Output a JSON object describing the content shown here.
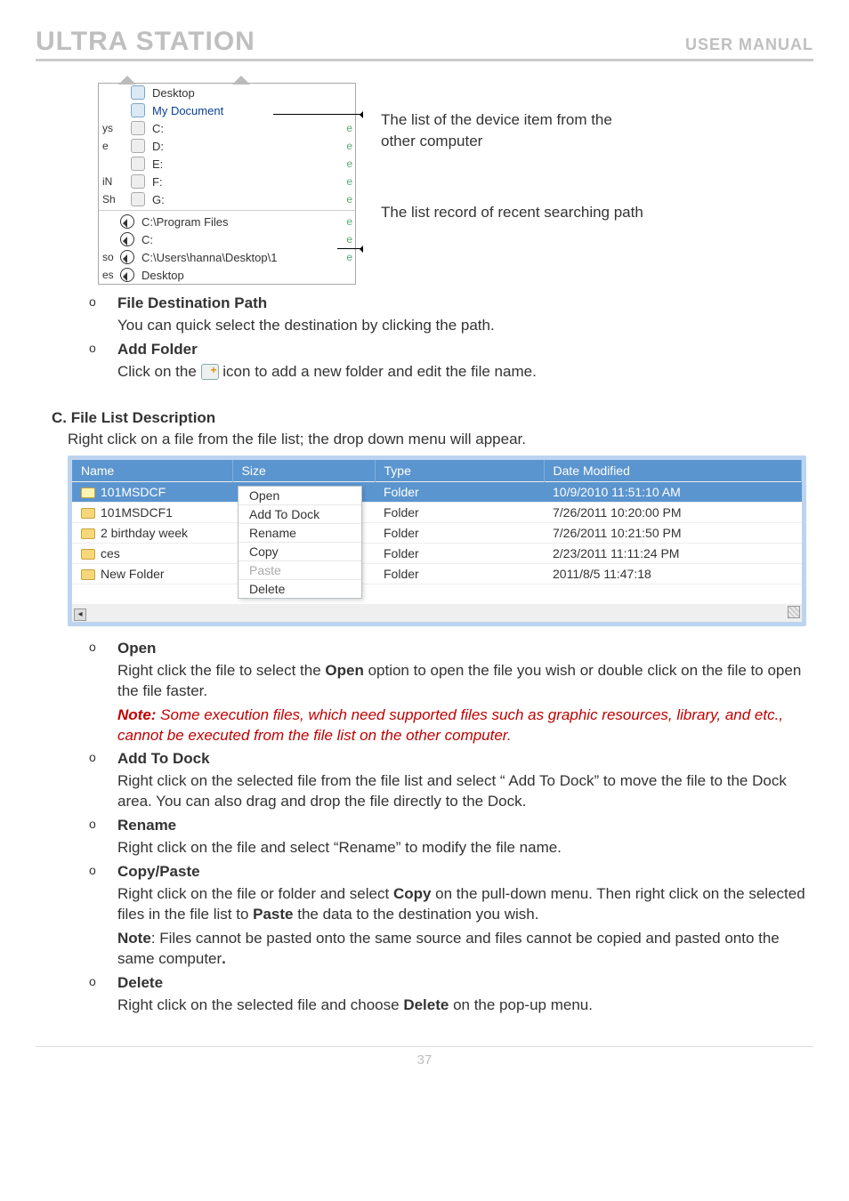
{
  "header": {
    "title": "ULTRA STATION",
    "subtitle": "USER MANUAL"
  },
  "addrcombo": {
    "left_letters": [
      "",
      "",
      "",
      "ys",
      "e",
      "",
      "iN",
      "Sh",
      "",
      "so",
      "es"
    ],
    "items": [
      {
        "label": "Desktop",
        "icon": "folder",
        "sel": false
      },
      {
        "label": "My Document",
        "icon": "folder",
        "sel": true
      },
      {
        "label": "C:",
        "icon": "drive",
        "sel": false
      },
      {
        "label": "D:",
        "icon": "drive",
        "sel": false
      },
      {
        "label": "E:",
        "icon": "drive",
        "sel": false
      },
      {
        "label": "F:",
        "icon": "drive",
        "sel": false
      },
      {
        "label": "G:",
        "icon": "drive",
        "sel": false
      }
    ],
    "history": [
      {
        "label": "C:\\Program Files"
      },
      {
        "label": "C:"
      },
      {
        "label": "C:\\Users\\hanna\\Desktop\\1"
      },
      {
        "label": "Desktop"
      }
    ],
    "right_letters": [
      "",
      "",
      "",
      "e",
      "e",
      "e",
      "e",
      "e",
      "e",
      "e",
      "e"
    ]
  },
  "side": {
    "line1a": "The list of the device item from the",
    "line1b": "other computer",
    "line2": "The list record of recent searching path"
  },
  "bullets": {
    "fdp_title": "File Destination Path",
    "fdp_text": "You can quick select the destination by clicking the path.",
    "af_title": "Add Folder",
    "af_text_pre": "Click on the ",
    "af_text_post": " icon to add a new folder and edit the file name."
  },
  "sectionC": {
    "head": "C.  File List Description",
    "sub": "Right click on a file from the file list; the drop down menu will appear."
  },
  "filelist": {
    "cols": {
      "c1": "Name",
      "c2": "Size",
      "c3": "Type",
      "c4": "Date Modified"
    },
    "rows": [
      {
        "name": "101MSDCF",
        "type": "Folder",
        "date": "10/9/2010 11:51:10 AM",
        "sel": true
      },
      {
        "name": "101MSDCF1",
        "type": "Folder",
        "date": "7/26/2011 10:20:00 PM",
        "sel": false
      },
      {
        "name": "2 birthday week",
        "type": "Folder",
        "date": "7/26/2011 10:21:50 PM",
        "sel": false
      },
      {
        "name": "ces",
        "type": "Folder",
        "date": "2/23/2011 11:11:24 PM",
        "sel": false
      },
      {
        "name": "New Folder",
        "type": "Folder",
        "date": "2011/8/5 11:47:18",
        "sel": false
      }
    ],
    "menu": {
      "open": "Open",
      "add": "Add To Dock",
      "rename": "Rename",
      "copy": "Copy",
      "paste": "Paste",
      "delete": "Delete"
    },
    "scroll_left": "◂",
    "scroll_right": " "
  },
  "descriptions": {
    "open": {
      "title": "Open",
      "p1": "Right click the file to select the ",
      "p1b": "Open",
      "p1c": " option to open the file you wish or double click on the file to open the file faster.",
      "note_label": "Note:",
      "note": " Some execution files, which need supported files such as graphic resources, library, and etc., cannot be executed from the file list on the other computer."
    },
    "addtodock": {
      "title": "Add To Dock",
      "p": "Right click on the selected file from the file list and select “ Add To Dock” to move the file to the Dock area. You can also drag and drop the file directly to the Dock."
    },
    "rename": {
      "title": "Rename",
      "p": "Right click on the file and select “Rename” to modify the file name."
    },
    "copypaste": {
      "title": "Copy/Paste",
      "p1": "Right click on the file or folder and select ",
      "p1b": "Copy",
      "p1c": " on the pull-down menu. Then right click on the selected files in the file list to ",
      "p1d": "Paste",
      "p1e": " the data to the destination you wish.",
      "note_label": "Note",
      "note": ": Files cannot be pasted onto the same source and files cannot be copied and pasted onto the same computer",
      "note_end": "."
    },
    "delete": {
      "title": "Delete",
      "p1": "Right click on the selected file and choose ",
      "p1b": "Delete",
      "p1c": " on the pop-up menu."
    }
  },
  "page_number": "37"
}
